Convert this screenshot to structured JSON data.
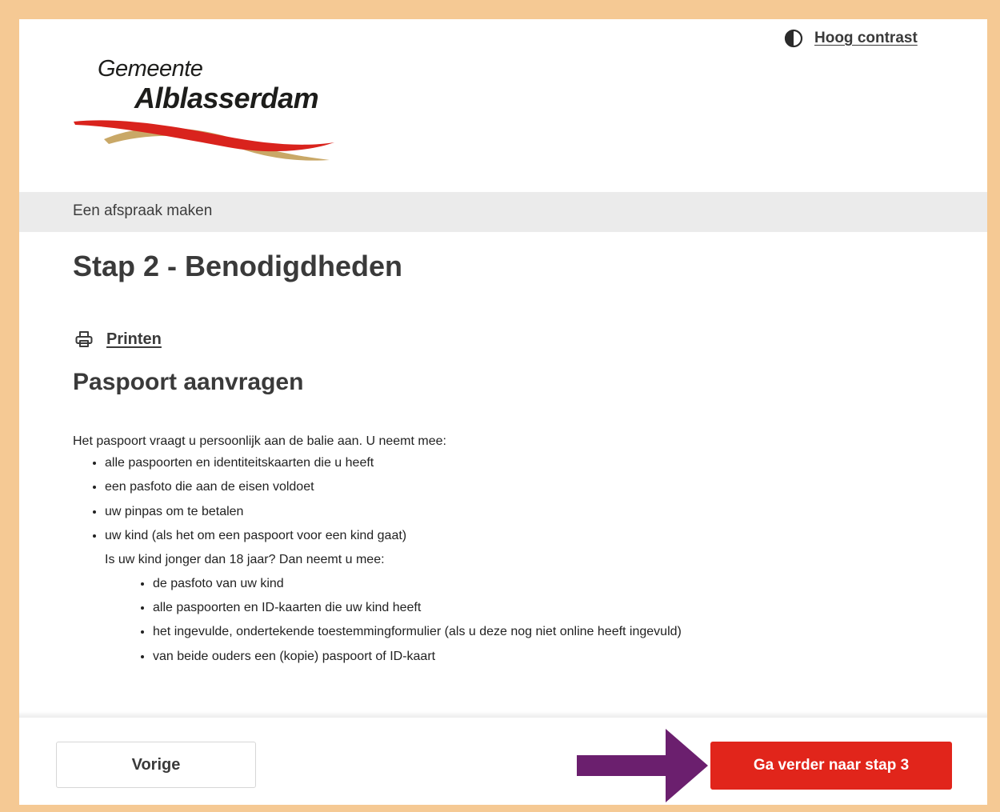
{
  "header": {
    "contrast_label": "Hoog contrast",
    "logo": {
      "line1": "Gemeente",
      "line2": "Alblasserdam"
    }
  },
  "breadcrumb": "Een afspraak maken",
  "page_title": "Stap 2 - Benodigdheden",
  "print_label": "Printen",
  "section": {
    "title": "Paspoort aanvragen",
    "intro": "Het paspoort vraagt u persoonlijk aan de balie aan. U neemt mee:",
    "items": [
      "alle paspoorten en identiteitskaarten die u heeft",
      "een pasfoto die aan de eisen voldoet",
      "uw pinpas om te betalen",
      "uw kind (als het om een paspoort voor een kind gaat)"
    ],
    "sub_intro": "Is uw kind jonger dan 18 jaar? Dan neemt u mee:",
    "sub_items": [
      "de pasfoto van uw kind",
      "alle paspoorten en ID-kaarten die uw kind heeft",
      "het ingevulde, ondertekende toestemmingformulier (als u deze nog niet online heeft ingevuld)",
      "van beide ouders een (kopie) paspoort of ID-kaart"
    ]
  },
  "footer": {
    "prev_label": "Vorige",
    "next_label": "Ga verder naar stap 3"
  },
  "colors": {
    "page_border": "#f5c994",
    "primary_button": "#e1251b",
    "annotation_arrow": "#6b1f6e",
    "logo_red": "#d9231d",
    "logo_gold": "#c9a867"
  }
}
